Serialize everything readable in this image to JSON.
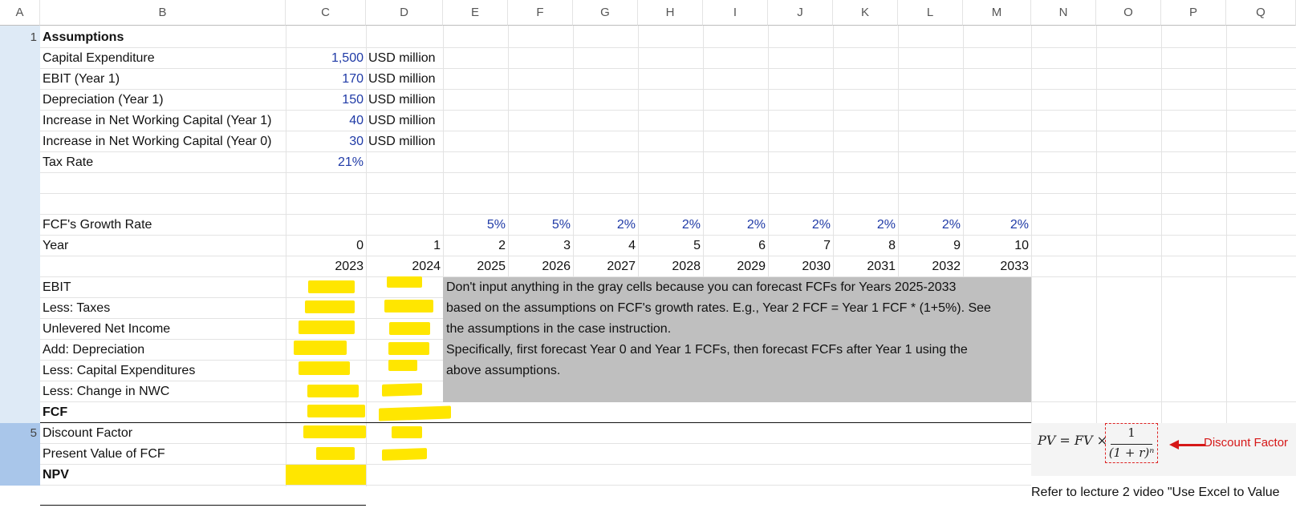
{
  "columns": [
    "A",
    "B",
    "C",
    "D",
    "E",
    "F",
    "G",
    "H",
    "I",
    "J",
    "K",
    "L",
    "M",
    "N",
    "O",
    "P",
    "Q"
  ],
  "row_headers": {
    "r1": "1",
    "r20": "5"
  },
  "assumptions": {
    "title": "Assumptions",
    "rows": [
      {
        "label": "Capital Expenditure",
        "value": "1,500",
        "unit": "USD million"
      },
      {
        "label": "EBIT (Year 1)",
        "value": "170",
        "unit": "USD million"
      },
      {
        "label": "Depreciation (Year 1)",
        "value": "150",
        "unit": "USD million"
      },
      {
        "label": "Increase in Net Working Capital (Year 1)",
        "value": "40",
        "unit": "USD million"
      },
      {
        "label": "Increase in Net Working Capital (Year 0)",
        "value": "30",
        "unit": "USD million"
      },
      {
        "label": "Tax Rate",
        "value": "21%",
        "unit": ""
      }
    ]
  },
  "growth": {
    "label": "FCF's Growth Rate",
    "values": [
      "",
      "",
      "5%",
      "5%",
      "2%",
      "2%",
      "2%",
      "2%",
      "2%",
      "2%",
      "2%"
    ]
  },
  "years": {
    "label": "Year",
    "index": [
      "0",
      "1",
      "2",
      "3",
      "4",
      "5",
      "6",
      "7",
      "8",
      "9",
      "10"
    ],
    "calendar": [
      "2023",
      "2024",
      "2025",
      "2026",
      "2027",
      "2028",
      "2029",
      "2030",
      "2031",
      "2032",
      "2033"
    ]
  },
  "fcf_rows": [
    "EBIT",
    "Less: Taxes",
    "Unlevered Net Income",
    "Add: Depreciation",
    "Less: Capital Expenditures",
    "Less: Change in NWC",
    "FCF",
    "Discount Factor",
    "Present Value of FCF",
    "NPV"
  ],
  "note": {
    "line1": "Don't input anything in the gray cells because you can forecast FCFs for Years 2025-2033",
    "line2": "based on the assumptions on FCF's growth rates. E.g., Year 2 FCF = Year 1 FCF * (1+5%). See",
    "line3": "the assumptions in the case instruction.",
    "line4": "Specifically, first forecast Year 0 and Year 1 FCFs, then forecast FCFs after Year 1 using the",
    "line5": "above assumptions."
  },
  "formula": {
    "lhs": "PV = FV ×",
    "numerator": "1",
    "denominator": "(1 + r)ⁿ",
    "pointer_label": "Discount Factor"
  },
  "refer_text": "Refer to lecture 2 video \"Use Excel to Value",
  "colors": {
    "highlight": "#ffe600",
    "input_blue": "#1f3aa6",
    "gray_cell": "#bfbfbf",
    "annotation_red": "#d61818",
    "row_header": "#deeaf6",
    "row_header_selected": "#a9c6ea"
  }
}
